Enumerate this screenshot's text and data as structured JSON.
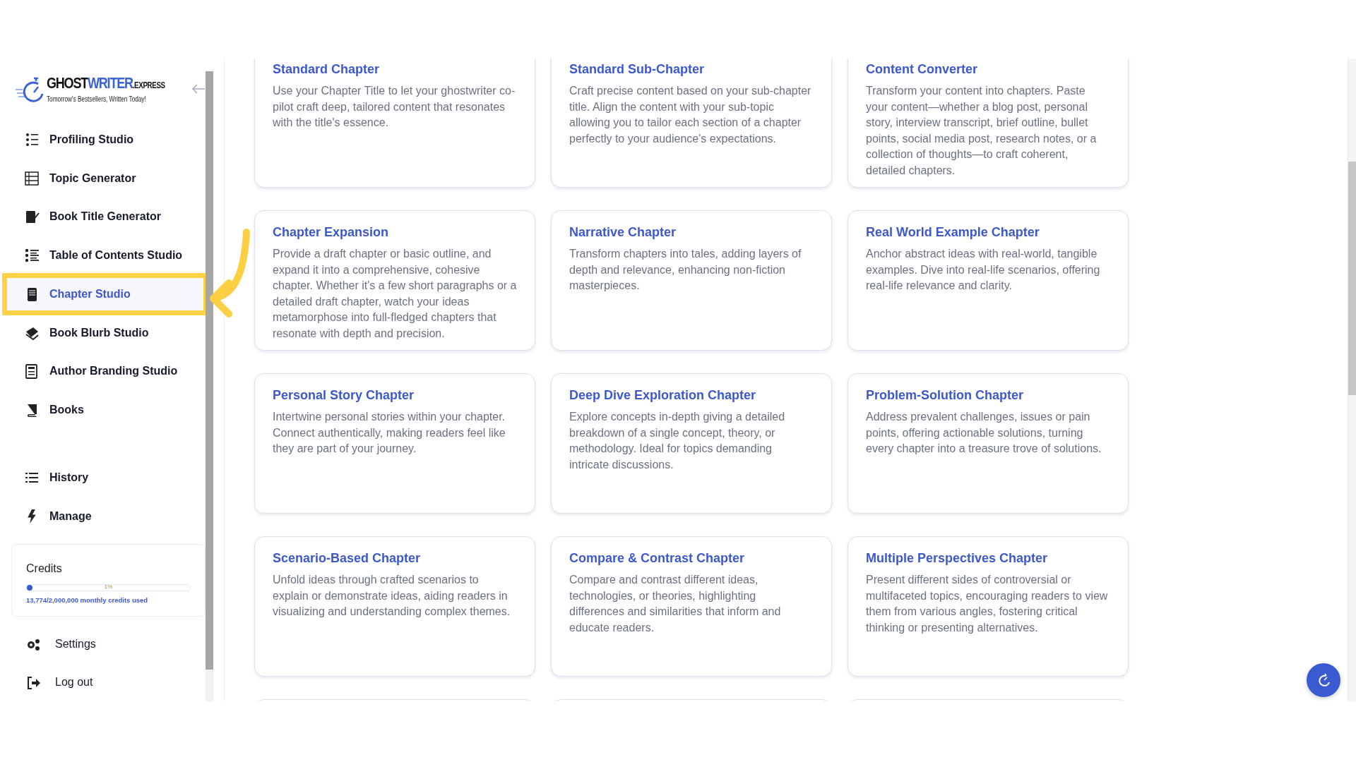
{
  "logo": {
    "name_dark": "GHOST",
    "name_accent": "WRITER",
    "suffix": ".EXPRESS",
    "tagline": "Tomorrow's Bestsellers, Written Today!"
  },
  "nav_items": [
    {
      "label": "Profiling Studio",
      "selected": false
    },
    {
      "label": "Topic Generator",
      "selected": false
    },
    {
      "label": "Book Title Generator",
      "selected": false
    },
    {
      "label": "Table of Contents Studio",
      "selected": false
    },
    {
      "label": "Chapter Studio",
      "selected": true
    },
    {
      "label": "Book Blurb Studio",
      "selected": false
    },
    {
      "label": "Author Branding Studio",
      "selected": false
    },
    {
      "label": "Books",
      "selected": false
    }
  ],
  "secondary_items": [
    {
      "label": "History",
      "selected": false
    },
    {
      "label": "Manage",
      "selected": false
    }
  ],
  "credits": {
    "title": "Credits",
    "level": 0.01,
    "reading": "1%",
    "usage": "13,774/2,000,000 monthly credits used"
  },
  "footer_items": [
    {
      "label": "Settings"
    },
    {
      "label": "Log out"
    }
  ],
  "cards": [
    {
      "title": "Standard Chapter",
      "description": "Use your Chapter Title to let your ghostwriter co-pilot craft deep, tailored content that resonates with the title's essence."
    },
    {
      "title": "Standard Sub-Chapter",
      "description": "Craft precise content based on your sub-chapter title. Align the content with your sub-topic allowing you to tailor each section of a chapter perfectly to your audience's expectations."
    },
    {
      "title": "Content Converter",
      "description": "Transform your content into chapters. Paste your content—whether a blog post, personal story, interview transcript, brief outline, bullet points, social media post, research notes, or a collection of thoughts—to craft coherent, detailed chapters."
    },
    {
      "title": "Chapter Expansion",
      "description": "Provide a draft chapter or basic outline, and expand it into a comprehensive, cohesive chapter. Whether it's a few short paragraphs or a detailed draft chapter, watch your ideas metamorphose into full-fledged chapters that resonate with depth and precision."
    },
    {
      "title": "Narrative Chapter",
      "description": "Transform chapters into tales, adding layers of depth and relevance, enhancing non-fiction masterpieces."
    },
    {
      "title": "Real World Example Chapter",
      "description": "Anchor abstract ideas with real-world, tangible examples. Dive into real-life scenarios, offering real-life relevance and clarity."
    },
    {
      "title": "Personal Story Chapter",
      "description": "Intertwine personal stories within your chapter. Connect authentically, making readers feel like they are part of your journey."
    },
    {
      "title": "Deep Dive Exploration Chapter",
      "description": "Explore concepts in-depth giving a detailed breakdown of a single concept, theory, or methodology. Ideal for topics demanding intricate discussions."
    },
    {
      "title": "Problem-Solution Chapter",
      "description": "Address prevalent challenges, issues or pain points, offering actionable solutions, turning every chapter into a treasure trove of solutions."
    },
    {
      "title": "Scenario-Based Chapter",
      "description": "Unfold ideas through crafted scenarios to explain or demonstrate ideas, aiding readers in visualizing and understanding complex themes."
    },
    {
      "title": "Compare & Contrast Chapter",
      "description": "Compare and contrast different ideas, technologies, or theories, highlighting differences and similarities that inform and educate readers."
    },
    {
      "title": "Multiple Perspectives Chapter",
      "description": "Present different sides of controversial or multifaceted topics, encouraging readers to view them from various angles, fostering critical thinking or presenting alternatives."
    }
  ]
}
